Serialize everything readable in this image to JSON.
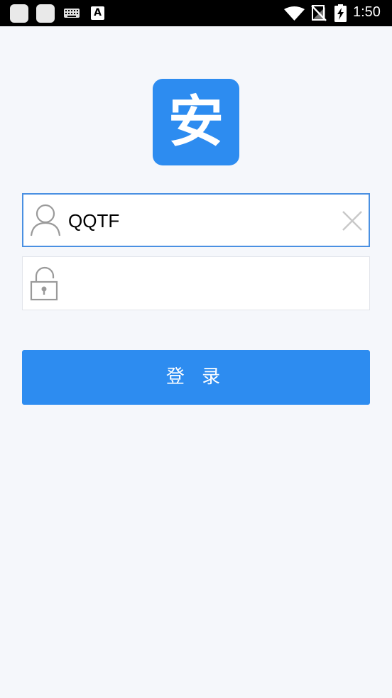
{
  "status_bar": {
    "time": "1:50",
    "input_method_icon_letter": "A",
    "icons": [
      "app-notification-icon",
      "app-notification-icon",
      "keyboard-icon",
      "input-method-icon",
      "wifi-icon",
      "no-signal-icon",
      "battery-charging-icon"
    ]
  },
  "logo": {
    "text": "安",
    "background": "#2d8cf0"
  },
  "login_form": {
    "username": {
      "value": "QQTF",
      "icon": "user-icon",
      "clear_icon": "close-icon"
    },
    "password": {
      "value": "",
      "icon": "lock-icon"
    },
    "submit_label": "登 录",
    "accent_color": "#2d8cf0",
    "focus_border_color": "#4a90e2"
  }
}
